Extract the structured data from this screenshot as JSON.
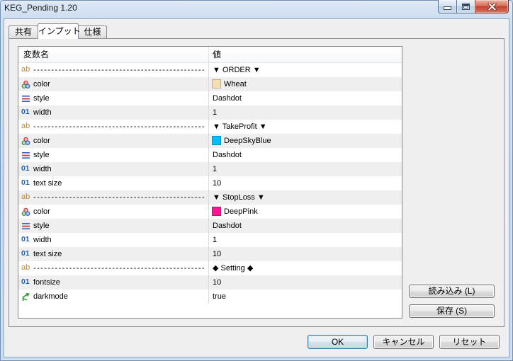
{
  "window": {
    "title": "KEG_Pending 1.20",
    "controls": {
      "minimize": {
        "icon": "minimize-icon"
      },
      "maximize": {
        "icon": "maximize-icon"
      },
      "close": {
        "icon": "close-icon",
        "color": "#c4432b"
      }
    }
  },
  "tabs": [
    {
      "label": "共有",
      "selected": false
    },
    {
      "label": "インプット",
      "selected": true
    },
    {
      "label": "仕様",
      "selected": false
    }
  ],
  "inputs": {
    "columns": {
      "name": "変数名",
      "value": "値"
    },
    "rows": [
      {
        "icon": "string-type-icon",
        "icon_glyph": "ab",
        "name": "------------------------------------------------",
        "value": "▼ ORDER ▼"
      },
      {
        "icon": "color-type-icon",
        "name": "color",
        "value": "Wheat",
        "swatch": "#F5DEB3"
      },
      {
        "icon": "line-style-icon",
        "name": "style",
        "value": "Dashdot"
      },
      {
        "icon": "integer-type-icon",
        "icon_glyph": "01",
        "name": "width",
        "value": "1"
      },
      {
        "icon": "string-type-icon",
        "icon_glyph": "ab",
        "name": "------------------------------------------------",
        "value": "▼ TakeProfit ▼"
      },
      {
        "icon": "color-type-icon",
        "name": "color",
        "value": "DeepSkyBlue",
        "swatch": "#00BFFF"
      },
      {
        "icon": "line-style-icon",
        "name": "style",
        "value": "Dashdot"
      },
      {
        "icon": "integer-type-icon",
        "icon_glyph": "01",
        "name": "width",
        "value": "1"
      },
      {
        "icon": "integer-type-icon",
        "icon_glyph": "01",
        "name": "text size",
        "value": "10"
      },
      {
        "icon": "string-type-icon",
        "icon_glyph": "ab",
        "name": "------------------------------------------------",
        "value": "▼ StopLoss ▼"
      },
      {
        "icon": "color-type-icon",
        "name": "color",
        "value": "DeepPink",
        "swatch": "#FF1493"
      },
      {
        "icon": "line-style-icon",
        "name": "style",
        "value": "Dashdot"
      },
      {
        "icon": "integer-type-icon",
        "icon_glyph": "01",
        "name": "width",
        "value": "1"
      },
      {
        "icon": "integer-type-icon",
        "icon_glyph": "01",
        "name": "text size",
        "value": "10"
      },
      {
        "icon": "string-type-icon",
        "icon_glyph": "ab",
        "name": "------------------------------------------------",
        "value": "◆ Setting ◆"
      },
      {
        "icon": "integer-type-icon",
        "icon_glyph": "01",
        "name": "fontsize",
        "value": "10"
      },
      {
        "icon": "bool-type-icon",
        "name": "darkmode",
        "value": "true"
      }
    ]
  },
  "side_buttons": {
    "load": "読み込み (L)",
    "save": "保存 (S)"
  },
  "footer_buttons": {
    "ok": "OK",
    "cancel": "キャンセル",
    "reset": "リセット"
  }
}
